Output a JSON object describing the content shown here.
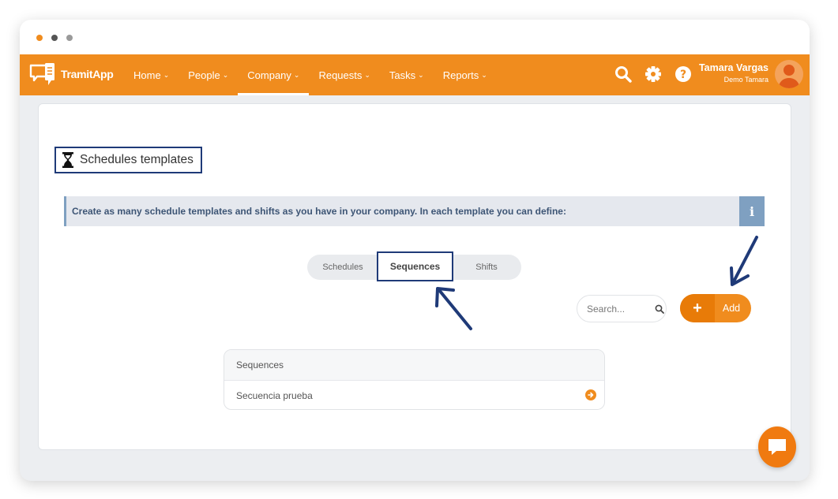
{
  "window": {
    "dot_colors": [
      "#f08c1e",
      "#555555",
      "#9a9a9a"
    ]
  },
  "topbar": {
    "brand": "TramitApp",
    "accent_color": "#f08c1e",
    "nav": [
      {
        "label": "Home",
        "icon": "chevron-down-icon"
      },
      {
        "label": "People",
        "icon": "chevron-down-icon"
      },
      {
        "label": "Company",
        "icon": "chevron-down-icon",
        "active": true
      },
      {
        "label": "Requests",
        "icon": "chevron-down-icon"
      },
      {
        "label": "Tasks",
        "icon": "chevron-down-icon"
      },
      {
        "label": "Reports",
        "icon": "chevron-down-icon"
      }
    ],
    "icons": [
      "search-icon",
      "gear-icon",
      "help-icon"
    ],
    "user": {
      "name": "Tamara Vargas",
      "company": "Demo Tamara"
    }
  },
  "page": {
    "title_icon": "hourglass-icon",
    "title": "Schedules templates",
    "info_text": "Create as many schedule templates and shifts as you have in your company. In each template you can define:",
    "info_icon": "info-icon",
    "tabs": [
      {
        "label": "Schedules"
      },
      {
        "label": "Sequences",
        "active": true
      },
      {
        "label": "Shifts"
      }
    ],
    "search": {
      "placeholder": "Search..."
    },
    "add_label": "Add",
    "table": {
      "header": "Sequences",
      "rows": [
        {
          "label": "Secuencia prueba",
          "icon": "arrow-right-circle-icon"
        }
      ]
    }
  },
  "annotation_color": "#1f3a78",
  "chat_icon": "chat-bubble-icon"
}
